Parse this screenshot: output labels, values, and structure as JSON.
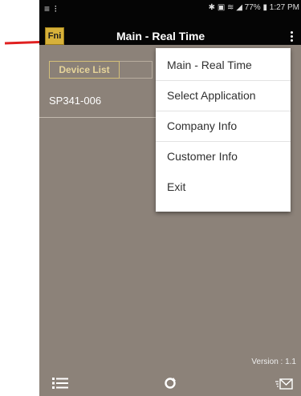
{
  "statusbar": {
    "left_glyphs": "≡ ⁝",
    "right_text": "✱ ▣ ≋ ◢ 77% ▮ 1:27 PM"
  },
  "appbar": {
    "logo_text": "Fni",
    "title": "Main - Real Time"
  },
  "tabs": {
    "device_list_label": "Device List"
  },
  "devices": [
    "SP341-006"
  ],
  "version_text": "Version : 1.1",
  "menu": {
    "items": [
      {
        "label": "Main - Real Time"
      },
      {
        "label": "Select Application"
      },
      {
        "label": "Company Info"
      },
      {
        "label": "Customer Info"
      },
      {
        "label": "Exit"
      }
    ]
  },
  "icons": {
    "overflow": "kebab-menu-icon",
    "bottom_left": "list-icon",
    "bottom_center": "refresh-icon",
    "bottom_right": "email-icon"
  },
  "colors": {
    "background": "#8c8279",
    "topbar": "#050505",
    "tab_border": "#d3bf79",
    "arrow": "#e02020",
    "menu_bg": "#ffffff"
  }
}
